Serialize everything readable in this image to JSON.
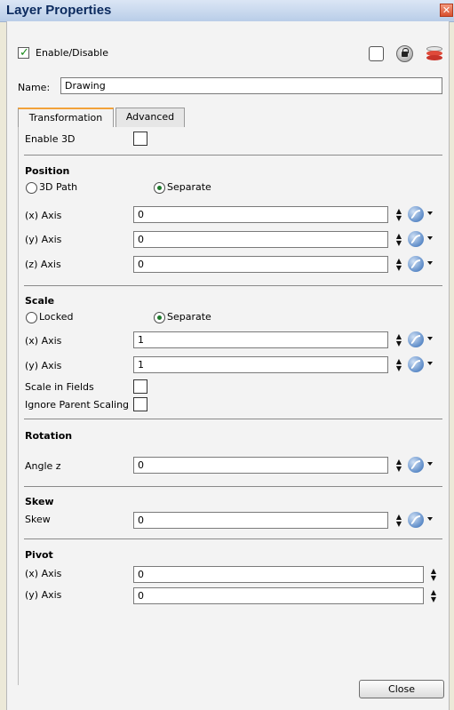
{
  "window": {
    "title": "Layer Properties",
    "close_glyph": "✕"
  },
  "header": {
    "enable_label": "Enable/Disable",
    "enable_checked": true,
    "enable_checkmark": "✓"
  },
  "name": {
    "label": "Name:",
    "value": "Drawing"
  },
  "tabs": [
    {
      "label": "Transformation",
      "active": true
    },
    {
      "label": "Advanced",
      "active": false
    }
  ],
  "enable3d": {
    "label": "Enable 3D"
  },
  "position": {
    "title": "Position",
    "option_a": "3D Path",
    "option_b": "Separate",
    "selected": "Separate",
    "x": {
      "label": "(x) Axis",
      "value": "0"
    },
    "y": {
      "label": "(y) Axis",
      "value": "0"
    },
    "z": {
      "label": "(z) Axis",
      "value": "0"
    }
  },
  "scale": {
    "title": "Scale",
    "option_a": "Locked",
    "option_b": "Separate",
    "selected": "Separate",
    "x": {
      "label": "(x) Axis",
      "value": "1"
    },
    "y": {
      "label": "(y) Axis",
      "value": "1"
    },
    "scale_in_fields": "Scale in Fields",
    "ignore_parent": "Ignore Parent Scaling"
  },
  "rotation": {
    "title": "Rotation",
    "angle_label": "Angle z",
    "value": "0"
  },
  "skew": {
    "title": "Skew",
    "label": "Skew",
    "value": "0"
  },
  "pivot": {
    "title": "Pivot",
    "x": {
      "label": "(x) Axis",
      "value": "0"
    },
    "y": {
      "label": "(y) Axis",
      "value": "0"
    }
  },
  "spinner_glyph": "▲▼",
  "buttons": {
    "close": "Close"
  },
  "icons": {
    "function": "function-curve-icon",
    "lock": "lock-icon",
    "layer": "layer-stack-icon",
    "spinner": "spinner-arrows-icon",
    "colors": {
      "accent_tab": "#f2a23a",
      "title_text": "#0b2a5e",
      "check": "#1a8a1a",
      "radio_dot": "#1e7a2c"
    }
  }
}
